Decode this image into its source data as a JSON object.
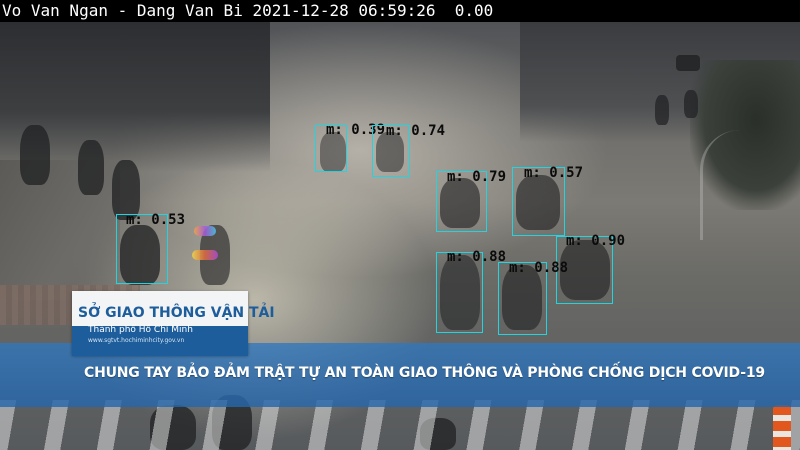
{
  "overlay": {
    "camera_text": "Vo Van Ngan - Dang Van Bi 2021-12-28 06:59:26  0.00"
  },
  "detections": [
    {
      "label": "m: 0.39"
    },
    {
      "label": "m: 0.74"
    },
    {
      "label": "m: 0.79"
    },
    {
      "label": "m: 0.57"
    },
    {
      "label": "m: 0.53"
    },
    {
      "label": "m: 0.90"
    },
    {
      "label": "m: 0.88"
    },
    {
      "label": "m: 0.88"
    }
  ],
  "banner": {
    "logo_title": "SỞ GIAO THÔNG VẬN TẢI",
    "logo_subtitle": "Thành phố Hồ Chí Minh",
    "logo_url": "www.sgtvt.hochiminhcity.gov.vn",
    "headline": "CHUNG TAY BẢO ĐẢM TRẬT TỰ AN TOÀN GIAO THÔNG VÀ PHÒNG CHỐNG DỊCH COVID-19"
  },
  "colors": {
    "box_stroke": "#22d4e0",
    "banner_blue": "#3078be",
    "logo_blue": "#1d5d9b"
  }
}
